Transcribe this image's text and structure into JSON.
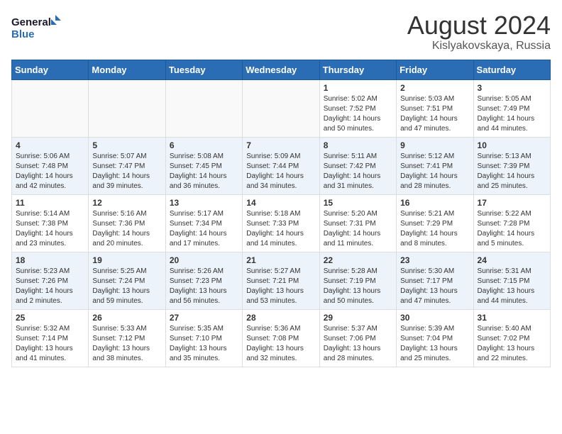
{
  "logo": {
    "line1": "General",
    "line2": "Blue"
  },
  "title": "August 2024",
  "location": "Kislyakovskaya, Russia",
  "weekdays": [
    "Sunday",
    "Monday",
    "Tuesday",
    "Wednesday",
    "Thursday",
    "Friday",
    "Saturday"
  ],
  "weeks": [
    [
      {
        "day": "",
        "info": ""
      },
      {
        "day": "",
        "info": ""
      },
      {
        "day": "",
        "info": ""
      },
      {
        "day": "",
        "info": ""
      },
      {
        "day": "1",
        "info": "Sunrise: 5:02 AM\nSunset: 7:52 PM\nDaylight: 14 hours\nand 50 minutes."
      },
      {
        "day": "2",
        "info": "Sunrise: 5:03 AM\nSunset: 7:51 PM\nDaylight: 14 hours\nand 47 minutes."
      },
      {
        "day": "3",
        "info": "Sunrise: 5:05 AM\nSunset: 7:49 PM\nDaylight: 14 hours\nand 44 minutes."
      }
    ],
    [
      {
        "day": "4",
        "info": "Sunrise: 5:06 AM\nSunset: 7:48 PM\nDaylight: 14 hours\nand 42 minutes."
      },
      {
        "day": "5",
        "info": "Sunrise: 5:07 AM\nSunset: 7:47 PM\nDaylight: 14 hours\nand 39 minutes."
      },
      {
        "day": "6",
        "info": "Sunrise: 5:08 AM\nSunset: 7:45 PM\nDaylight: 14 hours\nand 36 minutes."
      },
      {
        "day": "7",
        "info": "Sunrise: 5:09 AM\nSunset: 7:44 PM\nDaylight: 14 hours\nand 34 minutes."
      },
      {
        "day": "8",
        "info": "Sunrise: 5:11 AM\nSunset: 7:42 PM\nDaylight: 14 hours\nand 31 minutes."
      },
      {
        "day": "9",
        "info": "Sunrise: 5:12 AM\nSunset: 7:41 PM\nDaylight: 14 hours\nand 28 minutes."
      },
      {
        "day": "10",
        "info": "Sunrise: 5:13 AM\nSunset: 7:39 PM\nDaylight: 14 hours\nand 25 minutes."
      }
    ],
    [
      {
        "day": "11",
        "info": "Sunrise: 5:14 AM\nSunset: 7:38 PM\nDaylight: 14 hours\nand 23 minutes."
      },
      {
        "day": "12",
        "info": "Sunrise: 5:16 AM\nSunset: 7:36 PM\nDaylight: 14 hours\nand 20 minutes."
      },
      {
        "day": "13",
        "info": "Sunrise: 5:17 AM\nSunset: 7:34 PM\nDaylight: 14 hours\nand 17 minutes."
      },
      {
        "day": "14",
        "info": "Sunrise: 5:18 AM\nSunset: 7:33 PM\nDaylight: 14 hours\nand 14 minutes."
      },
      {
        "day": "15",
        "info": "Sunrise: 5:20 AM\nSunset: 7:31 PM\nDaylight: 14 hours\nand 11 minutes."
      },
      {
        "day": "16",
        "info": "Sunrise: 5:21 AM\nSunset: 7:29 PM\nDaylight: 14 hours\nand 8 minutes."
      },
      {
        "day": "17",
        "info": "Sunrise: 5:22 AM\nSunset: 7:28 PM\nDaylight: 14 hours\nand 5 minutes."
      }
    ],
    [
      {
        "day": "18",
        "info": "Sunrise: 5:23 AM\nSunset: 7:26 PM\nDaylight: 14 hours\nand 2 minutes."
      },
      {
        "day": "19",
        "info": "Sunrise: 5:25 AM\nSunset: 7:24 PM\nDaylight: 13 hours\nand 59 minutes."
      },
      {
        "day": "20",
        "info": "Sunrise: 5:26 AM\nSunset: 7:23 PM\nDaylight: 13 hours\nand 56 minutes."
      },
      {
        "day": "21",
        "info": "Sunrise: 5:27 AM\nSunset: 7:21 PM\nDaylight: 13 hours\nand 53 minutes."
      },
      {
        "day": "22",
        "info": "Sunrise: 5:28 AM\nSunset: 7:19 PM\nDaylight: 13 hours\nand 50 minutes."
      },
      {
        "day": "23",
        "info": "Sunrise: 5:30 AM\nSunset: 7:17 PM\nDaylight: 13 hours\nand 47 minutes."
      },
      {
        "day": "24",
        "info": "Sunrise: 5:31 AM\nSunset: 7:15 PM\nDaylight: 13 hours\nand 44 minutes."
      }
    ],
    [
      {
        "day": "25",
        "info": "Sunrise: 5:32 AM\nSunset: 7:14 PM\nDaylight: 13 hours\nand 41 minutes."
      },
      {
        "day": "26",
        "info": "Sunrise: 5:33 AM\nSunset: 7:12 PM\nDaylight: 13 hours\nand 38 minutes."
      },
      {
        "day": "27",
        "info": "Sunrise: 5:35 AM\nSunset: 7:10 PM\nDaylight: 13 hours\nand 35 minutes."
      },
      {
        "day": "28",
        "info": "Sunrise: 5:36 AM\nSunset: 7:08 PM\nDaylight: 13 hours\nand 32 minutes."
      },
      {
        "day": "29",
        "info": "Sunrise: 5:37 AM\nSunset: 7:06 PM\nDaylight: 13 hours\nand 28 minutes."
      },
      {
        "day": "30",
        "info": "Sunrise: 5:39 AM\nSunset: 7:04 PM\nDaylight: 13 hours\nand 25 minutes."
      },
      {
        "day": "31",
        "info": "Sunrise: 5:40 AM\nSunset: 7:02 PM\nDaylight: 13 hours\nand 22 minutes."
      }
    ]
  ]
}
